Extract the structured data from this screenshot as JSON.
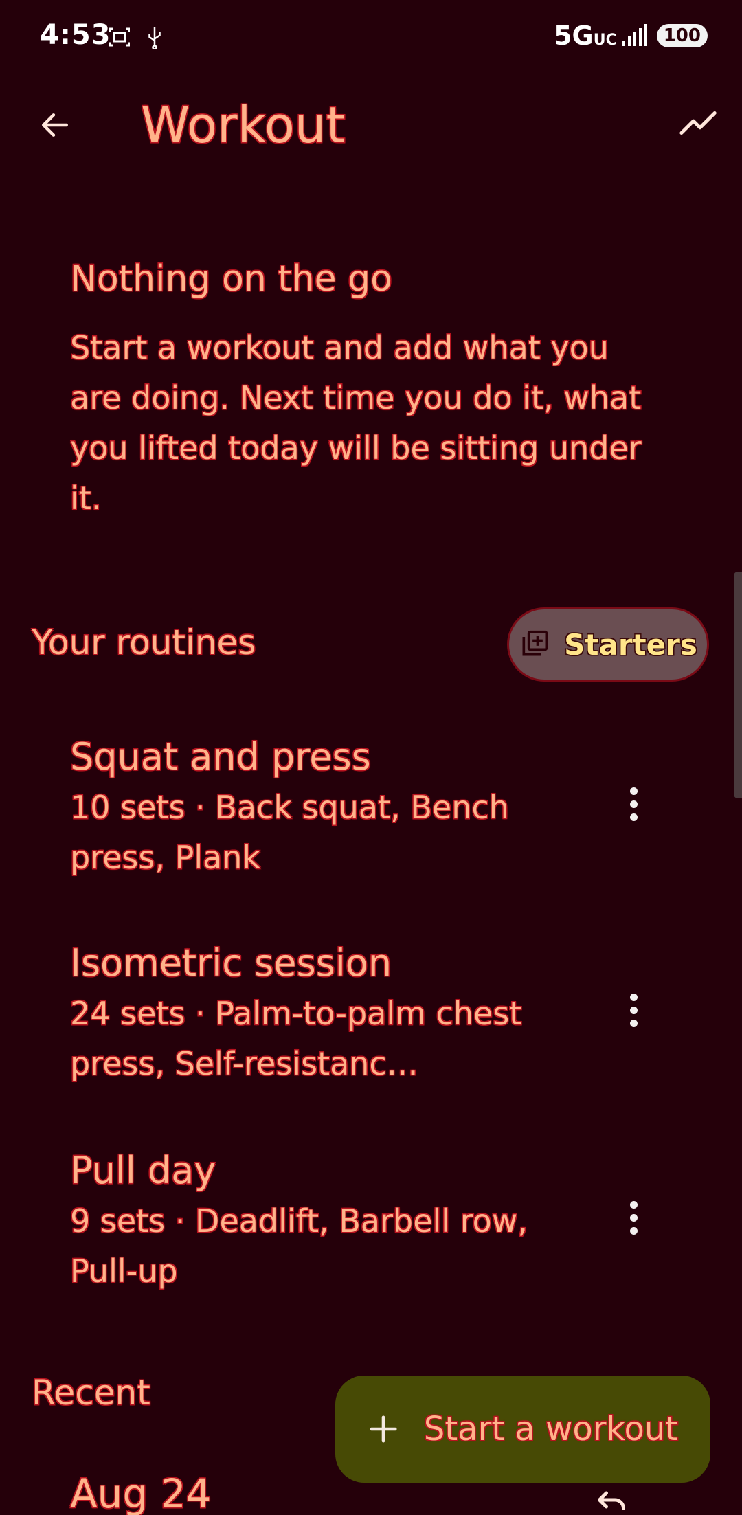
{
  "status_bar": {
    "time": "4:53",
    "network": "5G",
    "network_sub": "UC",
    "battery": "100"
  },
  "app_bar": {
    "title": "Workout",
    "back_icon": "arrow-left-icon",
    "trend_icon": "trending-up-icon"
  },
  "empty_state": {
    "title": "Nothing on the go",
    "body": "Start a workout and add what you are doing. Next time you do it, what you lifted today will be sitting under it."
  },
  "routines_section": {
    "title": "Your routines",
    "starters_button": "Starters",
    "starters_icon": "library-add-icon",
    "items": [
      {
        "name": "Squat and press",
        "description": "10 sets · Back squat, Bench press, Plank"
      },
      {
        "name": "Isometric session",
        "description": "24 sets · Palm-to-palm chest press, Self-resistanc…"
      },
      {
        "name": "Pull day",
        "description": "9 sets · Deadlift, Barbell row, Pull-up"
      }
    ]
  },
  "recent_section": {
    "title": "Recent",
    "first_date": "Aug 24"
  },
  "fab": {
    "label": "Start a workout",
    "icon": "plus-icon"
  },
  "colors": {
    "background": "#25000a",
    "text": "#ffb38a",
    "text_outline": "#b8131f",
    "fab_bg": "#474a05",
    "starters_bg": "#6a4e52",
    "starters_text": "#ffe58a"
  }
}
